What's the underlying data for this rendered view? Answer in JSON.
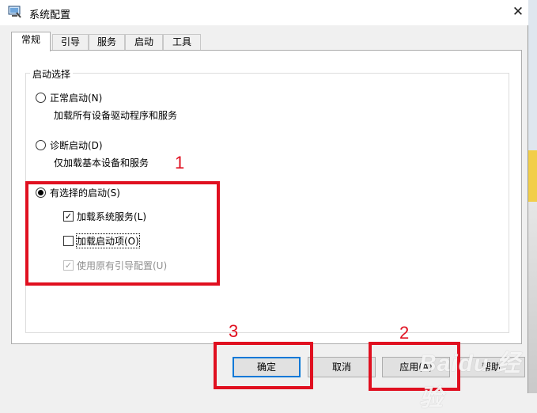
{
  "window": {
    "title": "系统配置",
    "close_glyph": "✕"
  },
  "tabs": [
    {
      "label": "常规",
      "active": true
    },
    {
      "label": "引导",
      "active": false
    },
    {
      "label": "服务",
      "active": false
    },
    {
      "label": "启动",
      "active": false
    },
    {
      "label": "工具",
      "active": false
    }
  ],
  "startup_group": {
    "legend": "启动选择",
    "normal": {
      "label": "正常启动(N)",
      "description": "加载所有设备驱动程序和服务",
      "selected": false
    },
    "diagnostic": {
      "label": "诊断启动(D)",
      "description": "仅加载基本设备和服务",
      "selected": false
    },
    "selective": {
      "label": "有选择的启动(S)",
      "selected": true,
      "load_system_services": {
        "label": "加载系统服务(L)",
        "checked": true
      },
      "load_startup_items": {
        "label": "加载启动项(O)",
        "checked": false
      },
      "use_original_boot": {
        "label": "使用原有引导配置(U)",
        "checked": true,
        "disabled": true
      }
    }
  },
  "buttons": {
    "ok": "确定",
    "cancel": "取消",
    "apply": "应用(A)",
    "help": "帮助"
  },
  "annotations": {
    "step1": "1",
    "step2": "2",
    "step3": "3",
    "color": "#e01020"
  },
  "watermark": "Baidu 经验"
}
